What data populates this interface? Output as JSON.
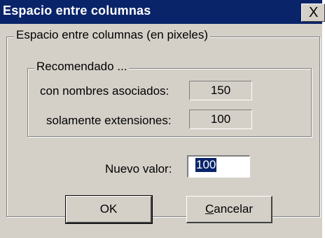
{
  "window": {
    "title": "Espacio entre columnas",
    "close_glyph": "X"
  },
  "group_main": {
    "legend": "Espacio entre columnas (en pixeles)"
  },
  "group_recommended": {
    "legend": "Recomendado ...",
    "rows": [
      {
        "label": "con nombres asociados:",
        "value": "150"
      },
      {
        "label": "solamente extensiones:",
        "value": "100"
      }
    ]
  },
  "new_value": {
    "label": "Nuevo valor:",
    "value": "100"
  },
  "buttons": {
    "ok": "OK",
    "cancel_prefix": "",
    "cancel_mnemonic": "C",
    "cancel_rest": "ancelar"
  },
  "colors": {
    "titlebar": "#0a246a",
    "face": "#d4d0c8"
  }
}
